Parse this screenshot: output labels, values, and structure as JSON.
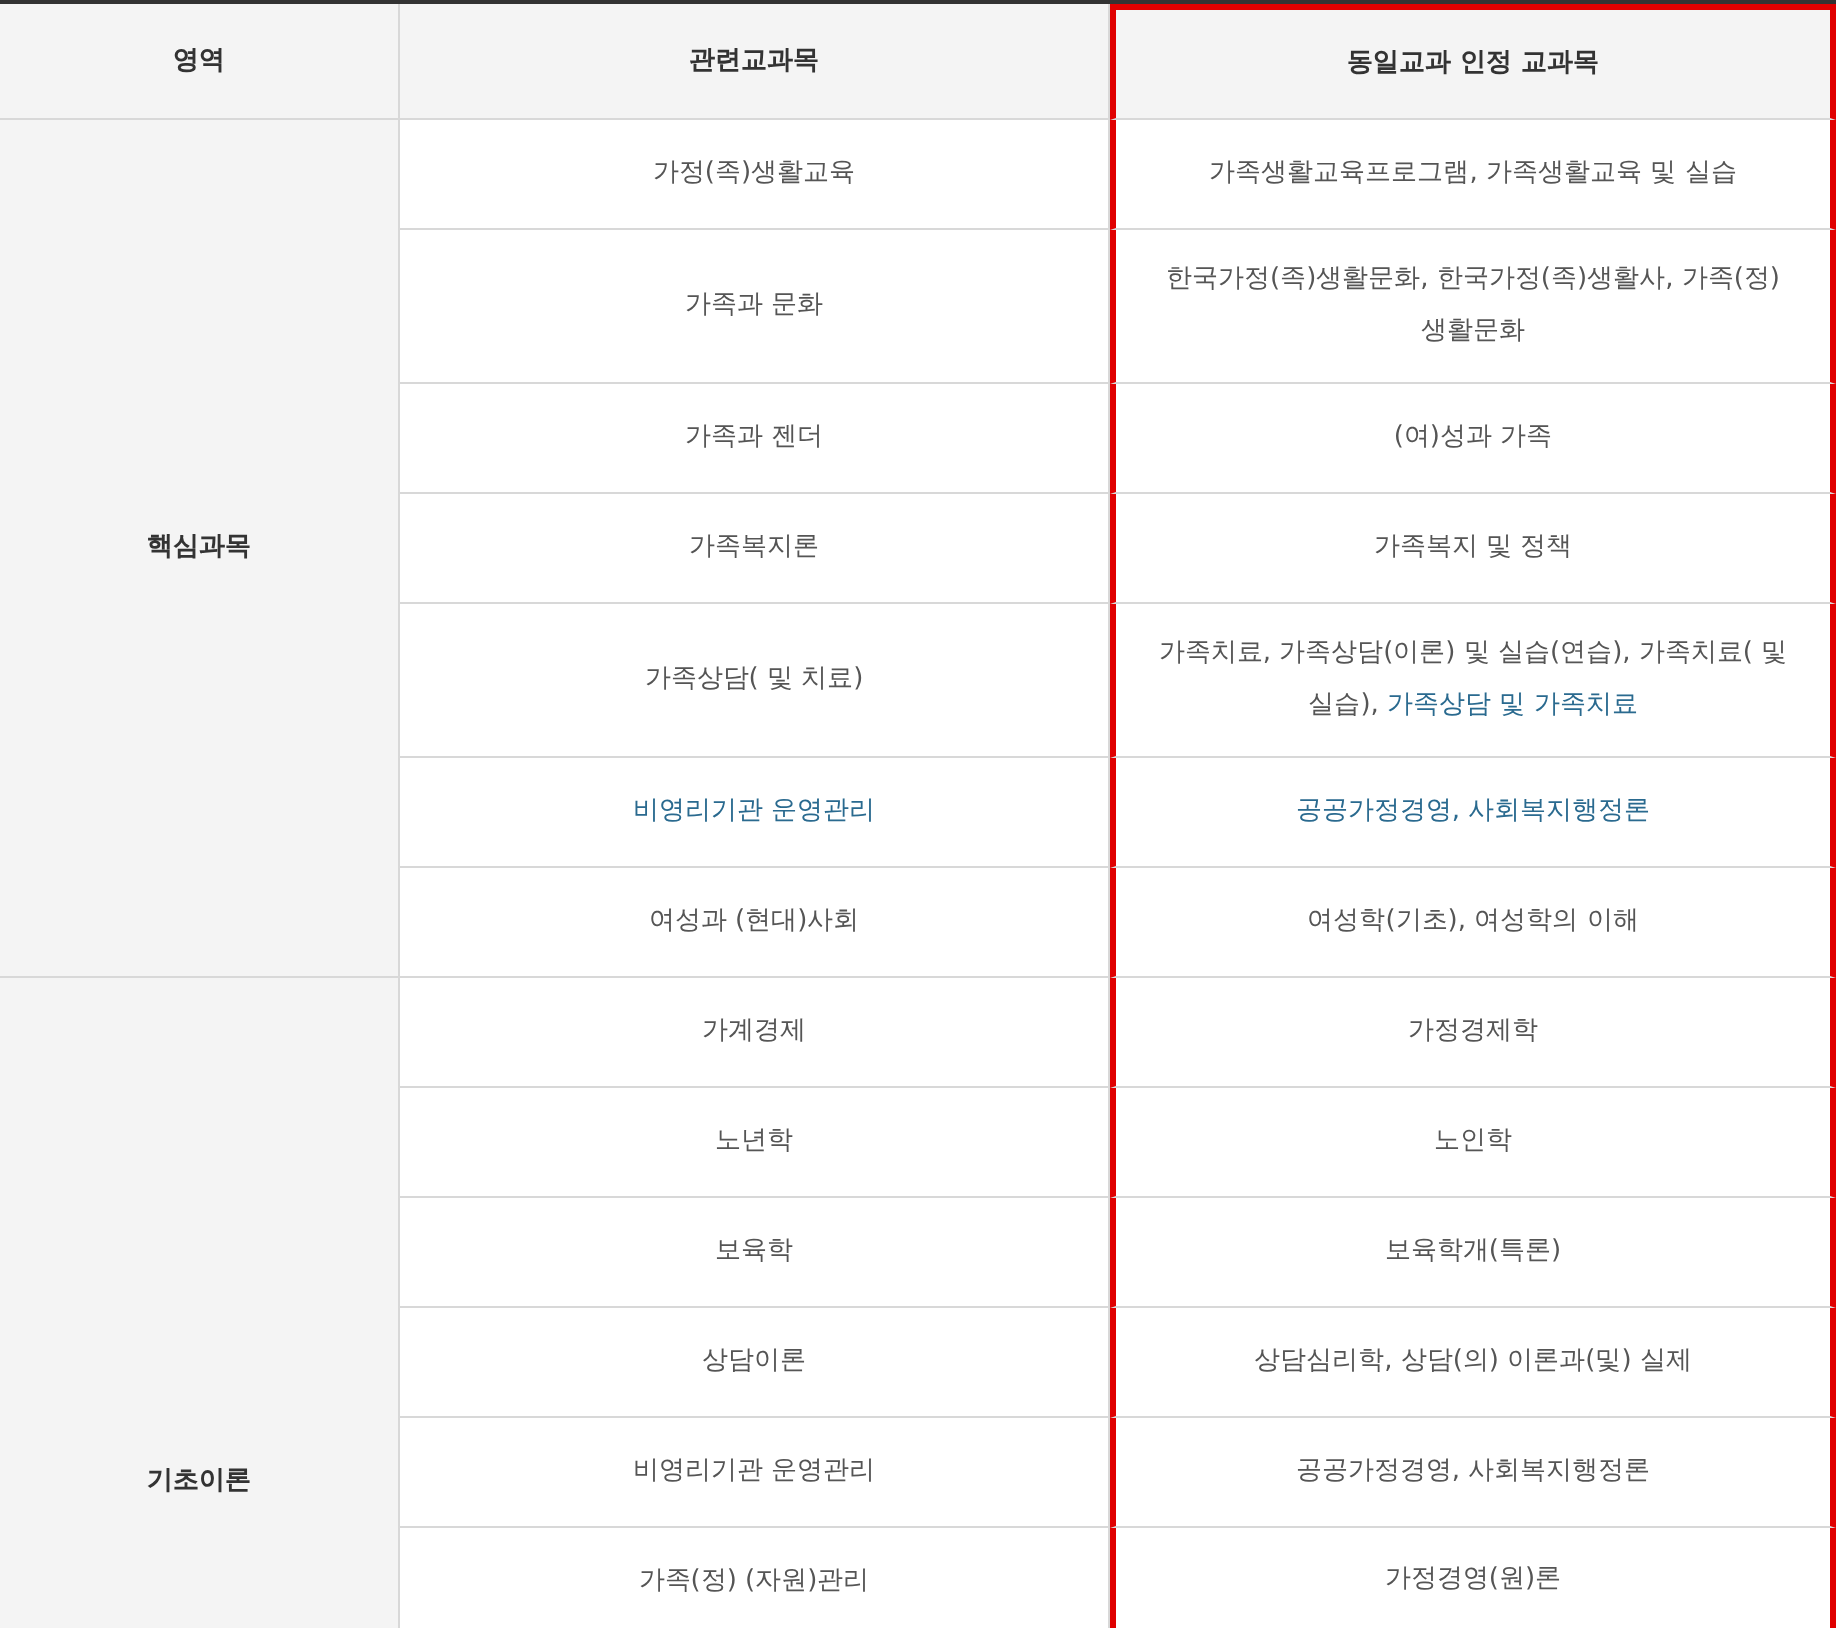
{
  "columns": [
    {
      "label": "영역",
      "highlighted": false
    },
    {
      "label": "관련교과목",
      "highlighted": false
    },
    {
      "label": "동일교과 인정 교과목",
      "highlighted": true
    }
  ],
  "groups": [
    {
      "area": "핵심과목",
      "rows": [
        {
          "subject": [
            {
              "text": "가정(족)생활교육",
              "linked": false
            }
          ],
          "equivalent": [
            {
              "text": "가족생활교육프로그램, 가족생활교육 및 실습",
              "linked": false
            }
          ]
        },
        {
          "subject": [
            {
              "text": "가족과 문화",
              "linked": false
            }
          ],
          "equivalent": [
            {
              "text": "한국가정(족)생활문화, 한국가정(족)생활사, 가족(정) 생활문화",
              "linked": false
            }
          ]
        },
        {
          "subject": [
            {
              "text": "가족과 젠더",
              "linked": false
            }
          ],
          "equivalent": [
            {
              "text": "(여)성과 가족",
              "linked": false
            }
          ]
        },
        {
          "subject": [
            {
              "text": "가족복지론",
              "linked": false
            }
          ],
          "equivalent": [
            {
              "text": "가족복지 및 정책",
              "linked": false
            }
          ]
        },
        {
          "subject": [
            {
              "text": "가족상담( 및 치료)",
              "linked": false
            }
          ],
          "equivalent": [
            {
              "text": "가족치료, 가족상담(이론) 및 실습(연습), 가족치료( 및 실습), ",
              "linked": false
            },
            {
              "text": "가족상담 및 가족치료",
              "linked": true
            }
          ]
        },
        {
          "subject": [
            {
              "text": "비영리기관 운영관리",
              "linked": true
            }
          ],
          "equivalent": [
            {
              "text": "공공가정경영, 사회복지행정론",
              "linked": true
            }
          ]
        },
        {
          "subject": [
            {
              "text": "여성과 (현대)사회",
              "linked": false
            }
          ],
          "equivalent": [
            {
              "text": "여성학(기초), 여성학의 이해",
              "linked": false
            }
          ]
        }
      ]
    },
    {
      "area": "기초이론",
      "rows": [
        {
          "subject": [
            {
              "text": "가계경제",
              "linked": false
            }
          ],
          "equivalent": [
            {
              "text": "가정경제학",
              "linked": false
            }
          ]
        },
        {
          "subject": [
            {
              "text": "노년학",
              "linked": false
            }
          ],
          "equivalent": [
            {
              "text": "노인학",
              "linked": false
            }
          ]
        },
        {
          "subject": [
            {
              "text": "보육학",
              "linked": false
            }
          ],
          "equivalent": [
            {
              "text": "보육학개(특론)",
              "linked": false
            }
          ]
        },
        {
          "subject": [
            {
              "text": "상담이론",
              "linked": false
            }
          ],
          "equivalent": [
            {
              "text": "상담심리학, 상담(의) 이론과(및) 실제",
              "linked": false
            }
          ]
        },
        {
          "subject": [
            {
              "text": "비영리기관 운영관리",
              "linked": false
            }
          ],
          "equivalent": [
            {
              "text": "공공가정경영, 사회복지행정론",
              "linked": false
            }
          ]
        },
        {
          "subject": [
            {
              "text": "가족(정) (자원)관리",
              "linked": false
            }
          ],
          "equivalent": [
            {
              "text": "가정경영(원)론",
              "linked": false
            }
          ]
        }
      ]
    }
  ]
}
